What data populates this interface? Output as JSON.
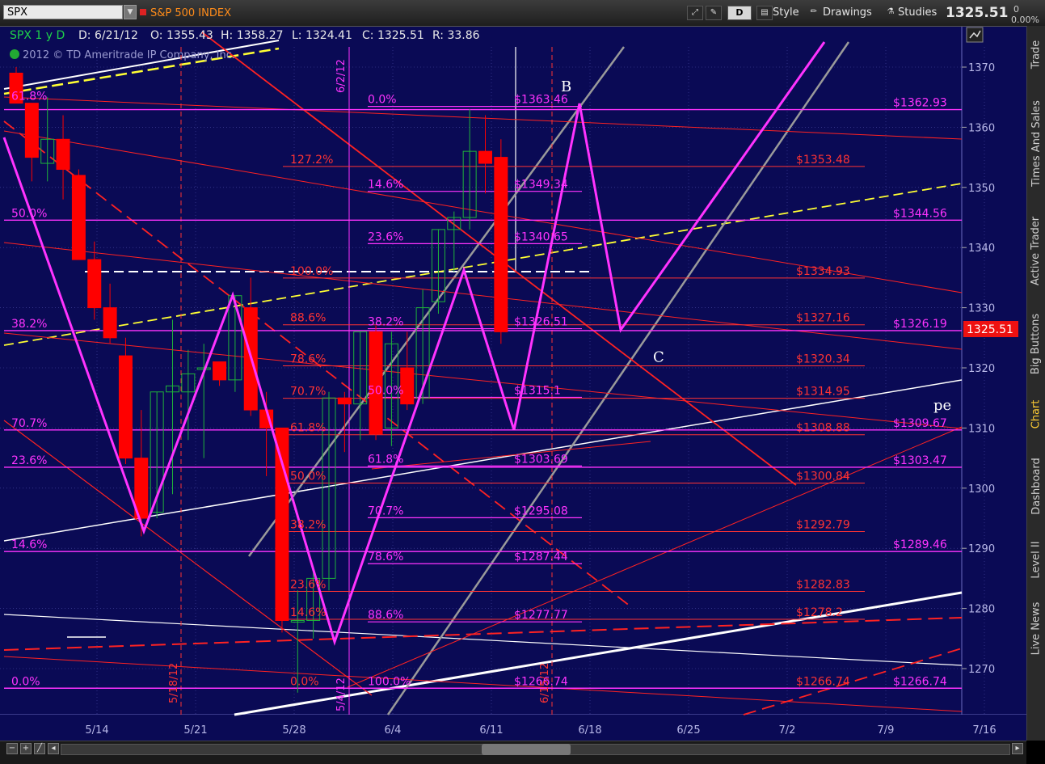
{
  "toolbar": {
    "symbol": "SPX",
    "index_name": "S&P 500 INDEX",
    "period_button": "D",
    "style_label": "Style",
    "drawings_label": "Drawings",
    "studies_label": "Studies",
    "last_price": "1325.51",
    "pct_change_a": "0",
    "pct_change_b": "0.00%"
  },
  "header": {
    "interval": "SPX 1 y D",
    "date": "D: 6/21/12",
    "open": "O: 1355.43",
    "high": "H: 1358.27",
    "low": "L: 1324.41",
    "close": "C: 1325.51",
    "range": "R: 33.86",
    "copyright": "2012 © TD Ameritrade IP Company, Inc."
  },
  "sidebar": {
    "tabs": [
      "Trade",
      "Times And Sales",
      "Active Trader",
      "Big Buttons",
      "Chart",
      "Dashboard",
      "Level II",
      "Live News"
    ],
    "active": "Chart"
  },
  "colors": {
    "background": "#0a0a55",
    "grid": "#4a4aa6",
    "candle_up": "#1fb23a",
    "candle_down": "#ff0000",
    "magenta": "#ff33ff",
    "fib_red": "#ff3333",
    "yellow_line": "#ffff33",
    "white_line": "#ffffff",
    "gray_line": "#9a9a9a",
    "price_tag": "#ee1111"
  },
  "chart_data": {
    "type": "candlestick",
    "y_range": [
      1262,
      1375
    ],
    "y_ticks": [
      1270,
      1280,
      1290,
      1300,
      1310,
      1320,
      1330,
      1340,
      1350,
      1360,
      1370
    ],
    "x_ticks": [
      "5/14",
      "5/21",
      "5/28",
      "6/4",
      "6/11",
      "6/18",
      "6/25",
      "7/2",
      "7/9",
      "7/16"
    ],
    "date_labels": [
      {
        "text": "6/2/12",
        "color": "#ff33ff"
      },
      {
        "text": "5/18/12",
        "color": "#ff3333"
      },
      {
        "text": "6/15/12",
        "color": "#ff3333"
      },
      {
        "text": "5/4/12",
        "color": "#ff33ff"
      }
    ],
    "candles": [
      {
        "o": 1369,
        "h": 1370,
        "l": 1364,
        "c": 1364
      },
      {
        "o": 1364,
        "h": 1364,
        "l": 1351,
        "c": 1355
      },
      {
        "o": 1354,
        "h": 1365,
        "l": 1351,
        "c": 1358
      },
      {
        "o": 1358,
        "h": 1362,
        "l": 1348,
        "c": 1353
      },
      {
        "o": 1352,
        "h": 1353,
        "l": 1338,
        "c": 1338
      },
      {
        "o": 1338,
        "h": 1341,
        "l": 1328,
        "c": 1330
      },
      {
        "o": 1330,
        "h": 1334,
        "l": 1324,
        "c": 1325
      },
      {
        "o": 1322,
        "h": 1325,
        "l": 1304,
        "c": 1305
      },
      {
        "o": 1305,
        "h": 1313,
        "l": 1292,
        "c": 1295
      },
      {
        "o": 1296,
        "h": 1316,
        "l": 1295,
        "c": 1316
      },
      {
        "o": 1316,
        "h": 1328,
        "l": 1299,
        "c": 1317
      },
      {
        "o": 1316,
        "h": 1323,
        "l": 1308,
        "c": 1319
      },
      {
        "o": 1320,
        "h": 1324,
        "l": 1305,
        "c": 1320
      },
      {
        "o": 1321,
        "h": 1321,
        "l": 1317,
        "c": 1318
      },
      {
        "o": 1318,
        "h": 1332,
        "l": 1316,
        "c": 1332
      },
      {
        "o": 1330,
        "h": 1335,
        "l": 1312,
        "c": 1313
      },
      {
        "o": 1313,
        "h": 1316,
        "l": 1302,
        "c": 1310
      },
      {
        "o": 1310,
        "h": 1310,
        "l": 1276,
        "c": 1278
      },
      {
        "o": 1278,
        "h": 1283,
        "l": 1266,
        "c": 1278
      },
      {
        "o": 1278,
        "h": 1286,
        "l": 1275,
        "c": 1285
      },
      {
        "o": 1285,
        "h": 1316,
        "l": 1283,
        "c": 1315
      },
      {
        "o": 1315,
        "h": 1316,
        "l": 1306,
        "c": 1314
      },
      {
        "o": 1314,
        "h": 1326,
        "l": 1308,
        "c": 1326
      },
      {
        "o": 1326,
        "h": 1327,
        "l": 1308,
        "c": 1309
      },
      {
        "o": 1310,
        "h": 1326,
        "l": 1307,
        "c": 1324
      },
      {
        "o": 1320,
        "h": 1326,
        "l": 1313,
        "c": 1314
      },
      {
        "o": 1315,
        "h": 1333,
        "l": 1314,
        "c": 1330
      },
      {
        "o": 1331,
        "h": 1343,
        "l": 1329,
        "c": 1343
      },
      {
        "o": 1343,
        "h": 1346,
        "l": 1336,
        "c": 1345
      },
      {
        "o": 1345,
        "h": 1363,
        "l": 1343,
        "c": 1356
      },
      {
        "o": 1356,
        "h": 1362,
        "l": 1349,
        "c": 1354
      },
      {
        "o": 1355,
        "h": 1358,
        "l": 1324,
        "c": 1326
      }
    ],
    "price_levels": [
      {
        "price": 1362.93,
        "label": "$1362.93",
        "color": "#ff33ff"
      },
      {
        "price": 1353.48,
        "label": "$1353.48",
        "color": "#ff3333"
      },
      {
        "price": 1344.56,
        "label": "$1344.56",
        "color": "#ff33ff"
      },
      {
        "price": 1334.93,
        "label": "$1334.93",
        "color": "#ff3333"
      },
      {
        "price": 1327.16,
        "label": "$1327.16",
        "color": "#ff3333"
      },
      {
        "price": 1326.19,
        "label": "$1326.19",
        "color": "#ff33ff"
      },
      {
        "price": 1320.34,
        "label": "$1320.34",
        "color": "#ff3333"
      },
      {
        "price": 1314.95,
        "label": "$1314.95",
        "color": "#ff3333"
      },
      {
        "price": 1309.67,
        "label": "$1309.67",
        "color": "#ff33ff"
      },
      {
        "price": 1308.88,
        "label": "$1308.88",
        "color": "#ff3333"
      },
      {
        "price": 1303.47,
        "label": "$1303.47",
        "color": "#ff33ff"
      },
      {
        "price": 1300.84,
        "label": "$1300.84",
        "color": "#ff3333"
      },
      {
        "price": 1292.79,
        "label": "$1292.79",
        "color": "#ff3333"
      },
      {
        "price": 1289.46,
        "label": "$1289.46",
        "color": "#ff33ff"
      },
      {
        "price": 1282.83,
        "label": "$1282.83",
        "color": "#ff3333"
      },
      {
        "price": 1278.2,
        "label": "$1278.2",
        "color": "#ff3333"
      },
      {
        "price": 1266.74,
        "label": "$1266.74",
        "color": "#ff3333"
      },
      {
        "price": 1266.74,
        "label": "$1266.74",
        "color": "#ff33ff"
      }
    ],
    "fib_retracement_mid": [
      {
        "price": 1363.46,
        "pct": "0.0%",
        "label": "$1363.46"
      },
      {
        "price": 1349.34,
        "pct": "14.6%",
        "label": "$1349.34"
      },
      {
        "price": 1340.65,
        "pct": "23.6%",
        "label": "$1340.65"
      },
      {
        "price": 1326.51,
        "pct": "38.2%",
        "label": "$1326.51"
      },
      {
        "price": 1315.1,
        "pct": "50.0%",
        "label": "$1315.1"
      },
      {
        "price": 1303.69,
        "pct": "61.8%",
        "label": "$1303.69"
      },
      {
        "price": 1295.08,
        "pct": "70.7%",
        "label": "$1295.08"
      },
      {
        "price": 1287.44,
        "pct": "78.6%",
        "label": "$1287.44"
      },
      {
        "price": 1277.77,
        "pct": "88.6%",
        "label": "$1277.77"
      },
      {
        "price": 1266.74,
        "pct": "100.0%",
        "label": "$1266.74"
      }
    ],
    "fib_left": [
      {
        "price": 1364,
        "pct": "61.8%"
      },
      {
        "price": 1344.56,
        "pct": "50.0%"
      },
      {
        "price": 1326.19,
        "pct": "38.2%"
      },
      {
        "price": 1309.67,
        "pct": "70.7%"
      },
      {
        "price": 1303.47,
        "pct": "23.6%"
      },
      {
        "price": 1289.46,
        "pct": "14.6%"
      },
      {
        "price": 1266.74,
        "pct": "0.0%"
      }
    ],
    "fib_red_inner": [
      {
        "price": 1353.48,
        "pct": "127.2%"
      },
      {
        "price": 1334.93,
        "pct": "100.0%"
      },
      {
        "price": 1327.16,
        "pct": "88.6%"
      },
      {
        "price": 1320.34,
        "pct": "78.6%"
      },
      {
        "price": 1314.95,
        "pct": "70.7%"
      },
      {
        "price": 1308.88,
        "pct": "61.8%"
      },
      {
        "price": 1300.84,
        "pct": "50.0%"
      },
      {
        "price": 1292.79,
        "pct": "38.2%"
      },
      {
        "price": 1282.83,
        "pct": "23.6%"
      },
      {
        "price": 1278.2,
        "pct": "14.6%"
      },
      {
        "price": 1266.74,
        "pct": "0.0%"
      }
    ],
    "pattern_labels": [
      {
        "text": "B",
        "price": 1366
      },
      {
        "text": "C",
        "price": 1321
      }
    ],
    "edge_text": "pe"
  }
}
